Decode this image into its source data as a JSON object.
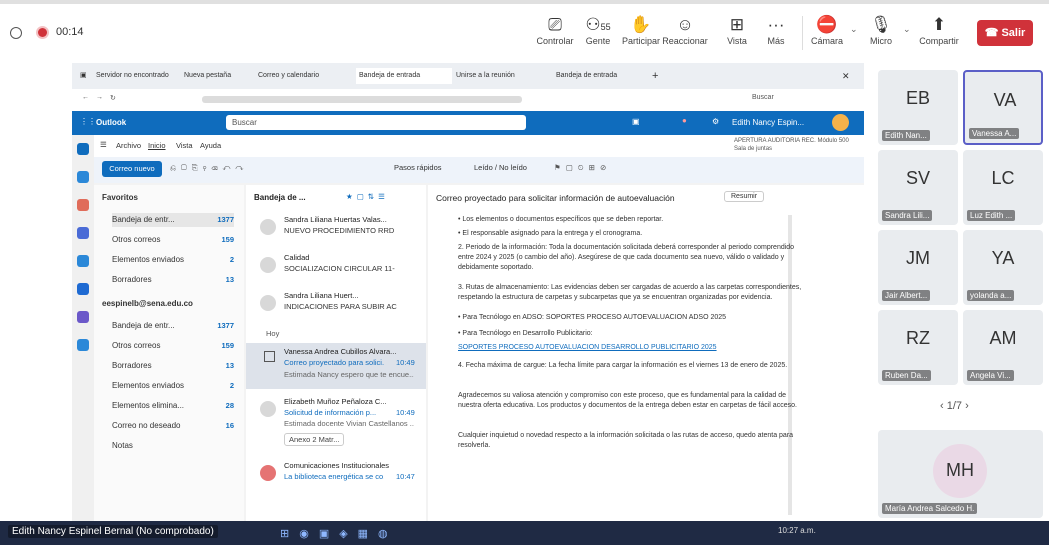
{
  "meeting": {
    "time": "00:14",
    "controls": {
      "control": "Controlar",
      "people_count": "55",
      "people": "Gente",
      "participate": "Participar",
      "react": "Reaccionar",
      "view": "Vista",
      "more": "Más",
      "camera": "Cámara",
      "mic": "Micro",
      "share": "Compartir",
      "leave": "Salir"
    },
    "colors": {
      "leave": "#d0323a",
      "outlook_bar": "#0f6cbd"
    },
    "participants": [
      {
        "initials": "EB",
        "name": "Edith Nan..."
      },
      {
        "initials": "VA",
        "name": "Vanessa A..."
      },
      {
        "initials": "SV",
        "name": "Sandra Lili..."
      },
      {
        "initials": "LC",
        "name": "Luz Edith ..."
      },
      {
        "initials": "JM",
        "name": "Jair Albert..."
      },
      {
        "initials": "YA",
        "name": "yolanda a..."
      },
      {
        "initials": "RZ",
        "name": "Ruben Da..."
      },
      {
        "initials": "AM",
        "name": "Angela Vi..."
      }
    ],
    "pager": "1/7",
    "big_tile": {
      "initials": "MH",
      "name": "María Andrea Salcedo H."
    },
    "own_name": "Edith Nancy Espinel Bernal (No comprobado)"
  },
  "browser": {
    "tabs": [
      "Servidor no encontrado",
      "Nueva pestaña",
      "Correo y calendario",
      "Bandeja de entrada",
      "Unirse a la reunión",
      "Bandeja de entrada"
    ],
    "search": "Buscar"
  },
  "outlook": {
    "app_name": "Outlook",
    "search_placeholder": "Buscar",
    "user": "Edith Nancy Espin...",
    "menu": [
      "Archivo",
      "Inicio",
      "Vista",
      "Ayuda"
    ],
    "new_mail": "Correo nuevo",
    "quick_steps": "Pasos rápidos",
    "read_unread": "Leído / No leído",
    "notice": "APERTURA AUDITORIA REC. Módulo 500 Sala de juntas",
    "folders_header": "Favoritos",
    "favorites": [
      {
        "name": "Bandeja de entr...",
        "count": "1377"
      },
      {
        "name": "Otros correos",
        "count": "159"
      },
      {
        "name": "Elementos enviados",
        "count": "2"
      },
      {
        "name": "Borradores",
        "count": "13"
      }
    ],
    "account": "eespinelb@sena.edu.co",
    "account_folders": [
      {
        "name": "Bandeja de entr...",
        "count": "1377"
      },
      {
        "name": "Otros correos",
        "count": "159"
      },
      {
        "name": "Borradores",
        "count": "13"
      },
      {
        "name": "Elementos enviados",
        "count": "2"
      },
      {
        "name": "Elementos elimina...",
        "count": "28"
      },
      {
        "name": "Correo no deseado",
        "count": "16"
      },
      {
        "name": "Notas",
        "count": ""
      }
    ],
    "list_header": "Bandeja de ...",
    "today_label": "Hoy",
    "mails": [
      {
        "sender": "Sandra Liliana Huertas Valas...",
        "subject": "NUEVO PROCEDIMIENTO RRD",
        "preview": "",
        "time": ""
      },
      {
        "sender": "Calidad",
        "subject": "SOCIALIZACION CIRCULAR 11-",
        "preview": "",
        "time": ""
      },
      {
        "sender": "Sandra Liliana Huert...",
        "subject": "INDICACIONES PARA SUBIR AC",
        "preview": "",
        "time": ""
      },
      {
        "sender": "Vanessa Andrea Cubillos Alvara...",
        "subject": "Correo proyectado para solici...",
        "preview": "Estimada Nancy espero que te encue...",
        "time": "10:49"
      },
      {
        "sender": "Elizabeth Muñoz Peñaloza C...",
        "subject": "Solicitud de información p...",
        "preview": "Estimada docente Vivian Castellanos ...",
        "time": "10:49"
      },
      {
        "sender": "Comunicaciones Institucionales",
        "subject": "La biblioteca energética se co...",
        "preview": "",
        "time": "10:47"
      }
    ],
    "attachment": "Anexo 2 Matr...",
    "reading": {
      "subject": "Correo proyectado para solicitar información de autoevaluación",
      "summary_btn": "Resumir",
      "lines": [
        "• Los elementos o documentos específicos que se deben reportar.",
        "• El responsable asignado para la entrega y el cronograma.",
        "2. Periodo de la información: Toda la documentación solicitada deberá corresponder al periodo comprendido entre 2024 y 2025 (o cambio del año). Asegúrese de que cada documento sea nuevo, válido o validado y debidamente soportado.",
        "3. Rutas de almacenamiento: Las evidencias deben ser cargadas de acuerdo a las carpetas correspondientes, respetando la estructura de carpetas y subcarpetas que ya se encuentran organizadas por evidencia.",
        "• Para Tecnólogo en ADSO: SOPORTES PROCESO AUTOEVALUACION ADSO 2025",
        "• Para Tecnólogo en Desarrollo Publicitario:",
        "SOPORTES PROCESO AUTOEVALUACION DESARROLLO PUBLICITARIO 2025",
        "4. Fecha máxima de cargue: La fecha límite para cargar la información es el viernes 13 de enero de 2025.",
        "Agradecemos su valiosa atención y compromiso con este proceso, que es fundamental para la calidad de nuestra oferta educativa. Los productos y documentos de la entrega deben estar en carpetas de fácil acceso.",
        "Cualquier inquietud o novedad respecto a la información solicitada o las rutas de acceso, quedo atenta para resolverla."
      ]
    }
  },
  "taskbar": {
    "clock": "10:27 a.m."
  }
}
